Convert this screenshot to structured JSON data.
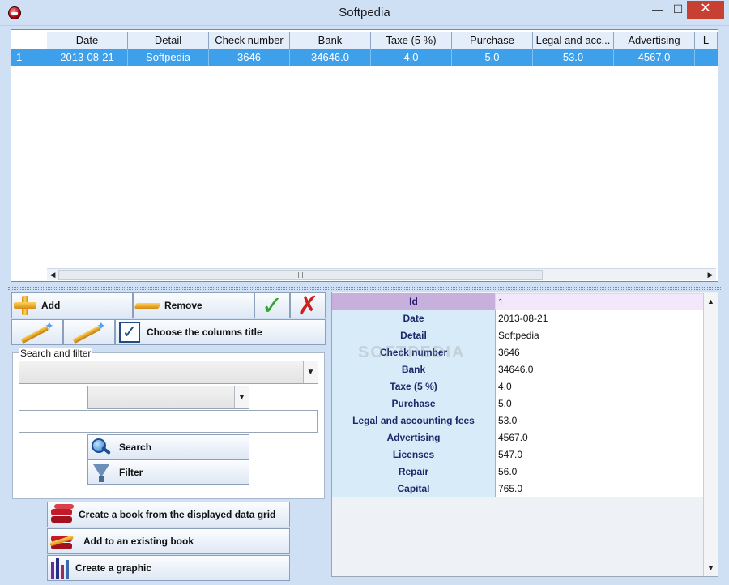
{
  "window": {
    "title": "Softpedia",
    "min_glyph": "—",
    "max_glyph": "☐",
    "close_glyph": "✕"
  },
  "grid": {
    "columns": [
      "Date",
      "Detail",
      "Check number",
      "Bank",
      "Taxe (5 %)",
      "Purchase",
      "Legal and acc...",
      "Advertising",
      "L"
    ],
    "rows": [
      {
        "id": "1",
        "cells": [
          "2013-08-21",
          "Softpedia",
          "3646",
          "34646.0",
          "4.0",
          "5.0",
          "53.0",
          "4567.0",
          ""
        ]
      }
    ],
    "scroll_left_glyph": "◀",
    "scroll_right_glyph": "▶"
  },
  "toolbar": {
    "add_label": "Add",
    "remove_label": "Remove",
    "validate_icon": "check-icon",
    "cancel_icon": "x-icon",
    "choose_columns_label": "Choose the columns title"
  },
  "filter": {
    "legend": "Search and filter",
    "field_combo_value": "",
    "operator_combo_value": "",
    "text_value": "",
    "search_label": "Search",
    "filter_label": "Filter"
  },
  "actions": {
    "create_book_label": "Create a book from the displayed data grid",
    "add_book_label": "Add to an existing book",
    "create_graphic_label": "Create a graphic"
  },
  "detail": {
    "header": {
      "label": "Id",
      "value": "1"
    },
    "fields": [
      {
        "label": "Date",
        "value": "2013-08-21"
      },
      {
        "label": "Detail",
        "value": "Softpedia"
      },
      {
        "label": "Check number",
        "value": "3646"
      },
      {
        "label": "Bank",
        "value": "34646.0"
      },
      {
        "label": "Taxe (5 %)",
        "value": "4.0"
      },
      {
        "label": "Purchase",
        "value": "5.0"
      },
      {
        "label": "Legal and accounting fees",
        "value": "53.0"
      },
      {
        "label": "Advertising",
        "value": "4567.0"
      },
      {
        "label": "Licenses",
        "value": "547.0"
      },
      {
        "label": "Repair",
        "value": "56.0"
      },
      {
        "label": "Capital",
        "value": "765.0"
      }
    ]
  },
  "watermark": "SOFTPEDIA",
  "colors": {
    "selection": "#3ea0ea",
    "label_bg": "#d7ebf9",
    "id_row": "#c7b0dc",
    "close": "#c74032"
  }
}
